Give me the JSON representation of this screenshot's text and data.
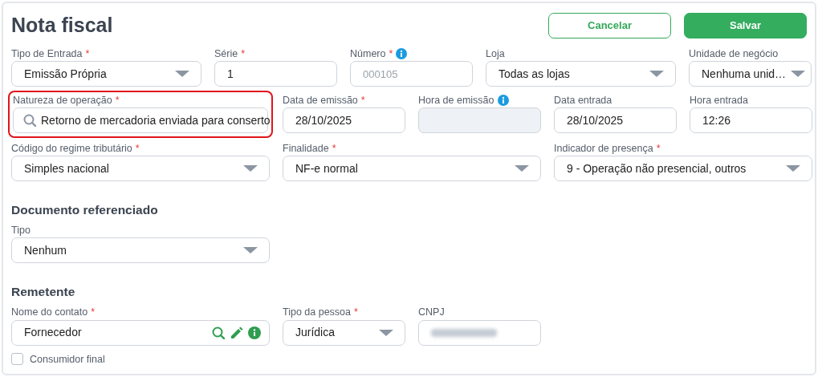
{
  "title": "Nota fiscal",
  "buttons": [
    {
      "label": "Cancelar",
      "kind": "outline"
    },
    {
      "label": "Salvar",
      "kind": "primary"
    }
  ],
  "rows": [
    {
      "fields": [
        {
          "label": "Tipo de Entrada",
          "required_mark": "*",
          "kind": "select",
          "value": "Emissão Própria"
        },
        {
          "label": "Série",
          "required_mark": "*",
          "kind": "input",
          "value": "1"
        },
        {
          "label": "Número",
          "required_mark": "*",
          "info": true,
          "kind": "input",
          "placeholder": "000105"
        },
        {
          "label": "Loja",
          "kind": "select",
          "value": "Todas as lojas"
        },
        {
          "label": "Unidade de negócio",
          "kind": "select",
          "value": "Nenhuma unid…"
        }
      ]
    },
    {
      "fields": [
        {
          "label": "Natureza de operação",
          "required_mark": "*",
          "kind": "search",
          "value": "Retorno de mercadoria enviada para conserto",
          "highlighted": true
        },
        {
          "label": "Data de emissão",
          "required_mark": "*",
          "kind": "input",
          "value": "28/10/2025"
        },
        {
          "label": "Hora de emissão",
          "info": true,
          "kind": "input",
          "disabled": true
        },
        {
          "label": "Data entrada",
          "kind": "input",
          "value": "28/10/2025"
        },
        {
          "label": "Hora entrada",
          "kind": "input",
          "value": "12:26"
        }
      ]
    },
    {
      "fields": [
        {
          "label": "Código do regime tributário",
          "required_mark": "*",
          "kind": "select",
          "value": "Simples nacional"
        },
        {
          "label": "Finalidade",
          "required_mark": "*",
          "kind": "select",
          "value": "NF-e normal"
        },
        {
          "label": "Indicador de presença",
          "required_mark": "*",
          "kind": "select",
          "value": "9 - Operação não presencial, outros"
        }
      ]
    },
    {
      "heading": "Documento referenciado",
      "fields": [
        {
          "label": "Tipo",
          "kind": "select",
          "value": "Nenhum"
        }
      ]
    },
    {
      "heading": "Remetente",
      "fields": [
        {
          "label": "Nome do contato",
          "required_mark": "*",
          "kind": "contact",
          "value": "Fornecedor"
        },
        {
          "label": "Tipo da pessoa",
          "required_mark": "*",
          "kind": "select",
          "value": "Jurídica"
        },
        {
          "label": "CNPJ",
          "kind": "input",
          "redacted": true
        }
      ]
    }
  ],
  "checkbox": {
    "label": "Consumidor final",
    "checked": false
  }
}
